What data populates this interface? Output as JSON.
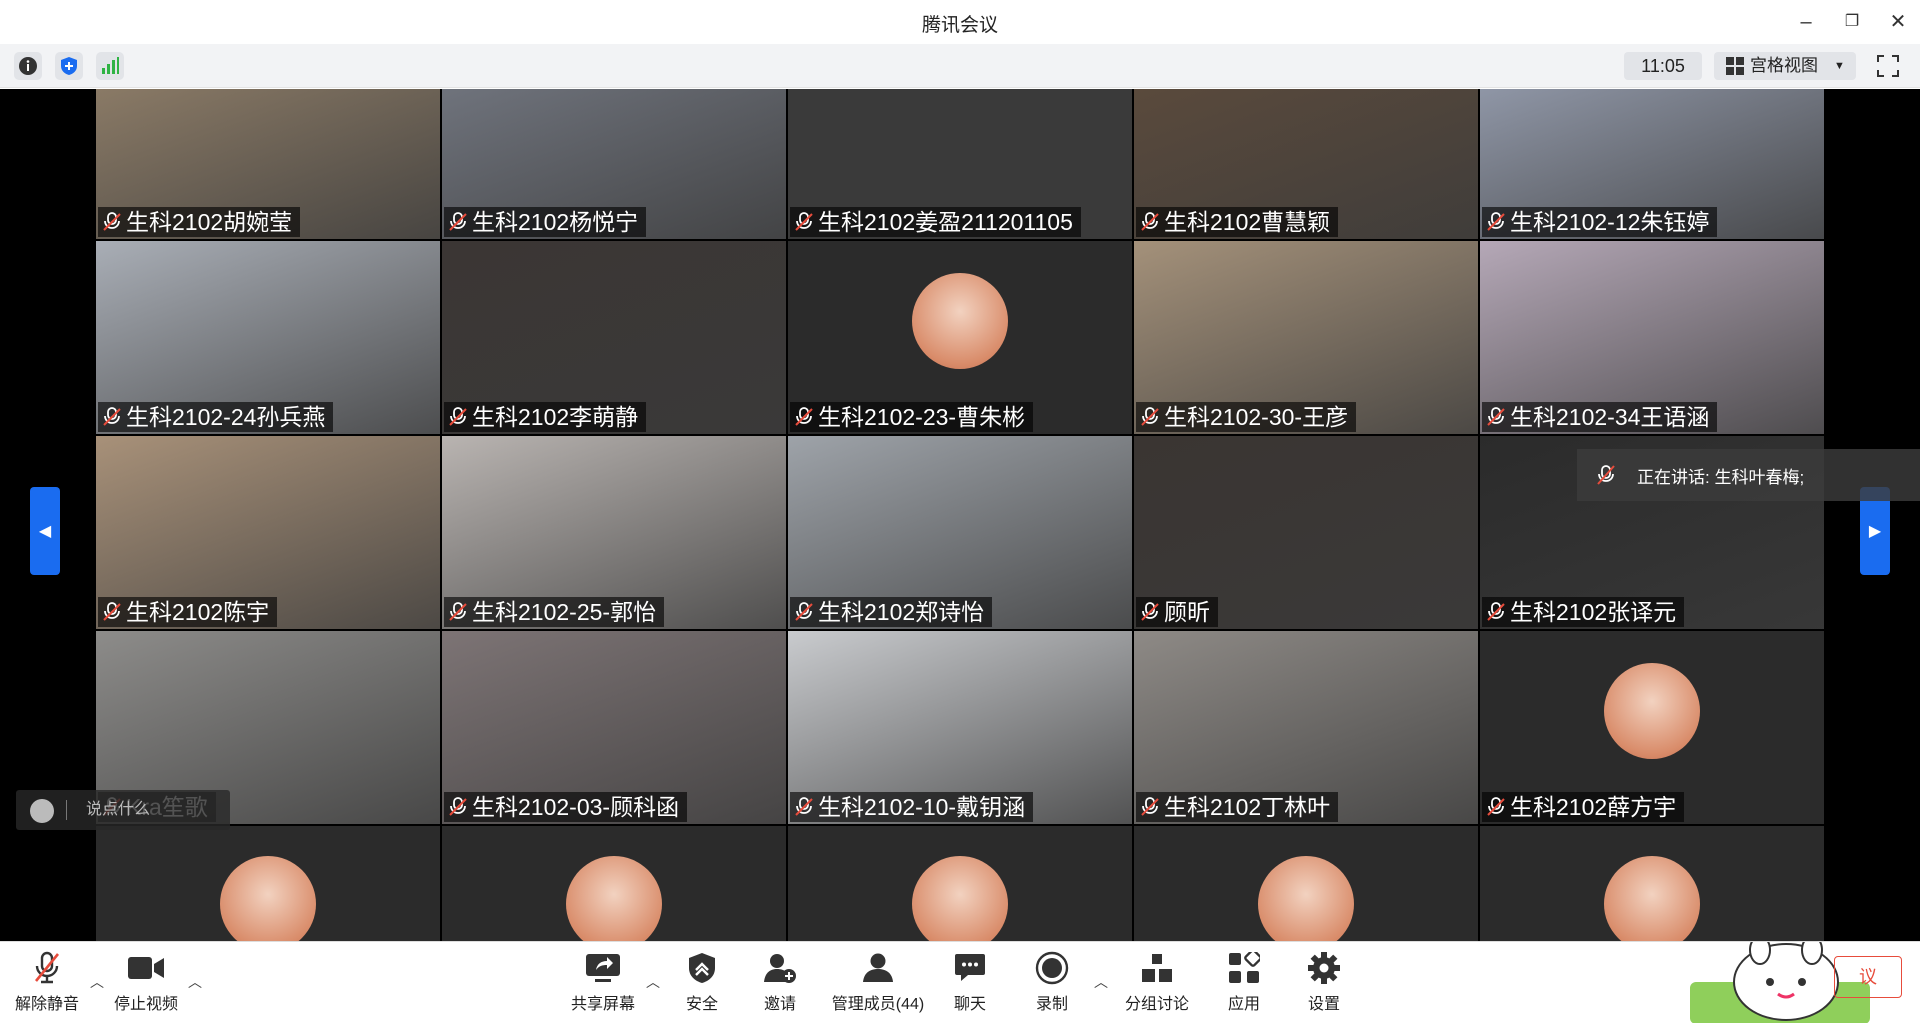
{
  "window": {
    "title": "腾讯会议"
  },
  "subbar": {
    "clock": "11:05",
    "view_mode": "宫格视图"
  },
  "speaking": {
    "text": "正在讲话: 生科叶春梅;"
  },
  "chat": {
    "placeholder": "说点什么"
  },
  "participants": [
    {
      "name": "生科2102胡婉莹",
      "kind": "video",
      "color": "#8a7a66"
    },
    {
      "name": "生科2102杨悦宁",
      "kind": "video",
      "color": "#6f737c"
    },
    {
      "name": "生科2102姜盈211201105",
      "kind": "video",
      "color": "#3a3a3a"
    },
    {
      "name": "生科2102曹慧颖",
      "kind": "video",
      "color": "#5a4a3c"
    },
    {
      "name": "生科2102-12朱钰婷",
      "kind": "video",
      "color": "#8f96a6"
    },
    {
      "name": "生科2102-24孙兵燕",
      "kind": "video",
      "color": "#a9aeb6"
    },
    {
      "name": "生科2102李萌静",
      "kind": "video",
      "color": "#3b3634"
    },
    {
      "name": "生科2102-23-曹朱彬",
      "kind": "avatar",
      "color": "#2b2b2b"
    },
    {
      "name": "生科2102-30-王彦",
      "kind": "video",
      "color": "#a4917a"
    },
    {
      "name": "生科2102-34王语涵",
      "kind": "video",
      "color": "#b5a8b7"
    },
    {
      "name": "生科2102陈宇",
      "kind": "video",
      "color": "#a89179"
    },
    {
      "name": "生科2102-25-郭怡",
      "kind": "video",
      "color": "#b9b4b1"
    },
    {
      "name": "生科2102郑诗怡",
      "kind": "video",
      "color": "#9ea3a9"
    },
    {
      "name": "顾昕",
      "kind": "video",
      "color": "#3a3532"
    },
    {
      "name": "生科2102张译元",
      "kind": "video",
      "color": "#2b2b2b"
    },
    {
      "name": "Kra笙歌",
      "kind": "video",
      "color": "#8d8c8a"
    },
    {
      "name": "生科2102-03-顾科函",
      "kind": "video",
      "color": "#7d7475"
    },
    {
      "name": "生科2102-10-戴钥涵",
      "kind": "video",
      "color": "#c9cbce"
    },
    {
      "name": "生科2102丁林叶",
      "kind": "video",
      "color": "#8e8a86"
    },
    {
      "name": "生科2102薛方宇",
      "kind": "avatar",
      "color": "#2b2b2b"
    },
    {
      "name": "",
      "kind": "avatar",
      "color": "#2b2b2b"
    },
    {
      "name": "",
      "kind": "avatar",
      "color": "#2b2b2b"
    },
    {
      "name": "",
      "kind": "avatar",
      "color": "#2b2b2b"
    },
    {
      "name": "",
      "kind": "avatar",
      "color": "#2b2b2b"
    },
    {
      "name": "",
      "kind": "avatar",
      "color": "#2b2b2b"
    }
  ],
  "toolbar": {
    "unmute": "解除静音",
    "stop_video": "停止视频",
    "share_screen": "共享屏幕",
    "security": "安全",
    "invite": "邀请",
    "manage_members": "管理成员(44)",
    "chat": "聊天",
    "record": "录制",
    "breakout": "分组讨论",
    "apps": "应用",
    "settings": "设置",
    "end": "议"
  },
  "colors": {
    "accent": "#1a6cf0",
    "end_red": "#e74c3c",
    "signal_green": "#2fb344"
  }
}
